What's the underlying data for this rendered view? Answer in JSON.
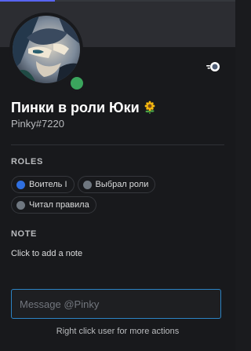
{
  "profile": {
    "display_name": "Пинки в роли Юки",
    "name_emoji": "sunflower-emoji",
    "tag": "Pinky#7220",
    "status": "online",
    "status_color": "#3ba55d",
    "avatar_icon": "anime-character-avatar",
    "badge_icon": "nitro-badge-icon"
  },
  "roles": {
    "title": "ROLES",
    "items": [
      {
        "label": "Воитель I",
        "color": "#2f6fe0"
      },
      {
        "label": "Выбрал роли",
        "color": "#6f7780"
      },
      {
        "label": "Читал правила",
        "color": "#6f7780"
      }
    ]
  },
  "note": {
    "title": "NOTE",
    "placeholder": "Click to add a note"
  },
  "message": {
    "placeholder": "Message @Pinky"
  },
  "footer": {
    "hint": "Right click user for more actions"
  },
  "colors": {
    "background": "#18191c",
    "accent": "#5865f2",
    "input_border": "#2c83c4"
  }
}
